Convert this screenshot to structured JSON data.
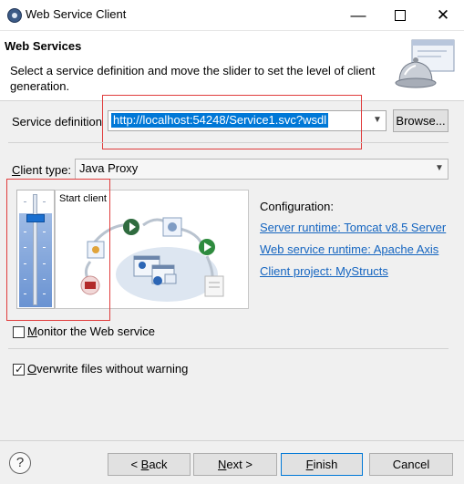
{
  "window": {
    "title": "Web Service Client",
    "minimize_glyph": "—",
    "close_glyph": "✕"
  },
  "banner": {
    "title": "Web Services",
    "description": "Select a service definition and move the slider to set the level of client generation."
  },
  "service_definition": {
    "label": "Service definition",
    "value": "http://localhost:54248/Service1.svc?wsdl",
    "browse_label": "Browse..."
  },
  "client_type": {
    "label_mnemonic": "C",
    "label_rest": "lient type:",
    "value": "Java Proxy"
  },
  "slider": {
    "current_level": "Start client"
  },
  "configuration": {
    "title": "Configuration:",
    "server_runtime": "Server runtime: Tomcat v8.5 Server",
    "web_service_runtime": "Web service runtime: Apache Axis",
    "client_project": "Client project: MyStructs"
  },
  "options": {
    "monitor_mnemonic": "M",
    "monitor_rest": "onitor the Web service",
    "monitor_checked": false,
    "overwrite_mnemonic": "O",
    "overwrite_rest": "verwrite files without warning",
    "overwrite_checked": true
  },
  "footer": {
    "help_glyph": "?",
    "back_prefix": "< ",
    "back_mnemonic": "B",
    "back_rest": "ack",
    "next_mnemonic": "N",
    "next_rest": "ext >",
    "finish_mnemonic": "F",
    "finish_rest": "inish",
    "cancel_label": "Cancel"
  },
  "icons": {
    "app": "web-service-gear-icon",
    "banner": "service-bell-icon",
    "dropdown": "chevron-down-icon",
    "help": "help-icon"
  },
  "colors": {
    "selection": "#0078d7",
    "link": "#1565c0",
    "annotation": "#e03c3c"
  }
}
